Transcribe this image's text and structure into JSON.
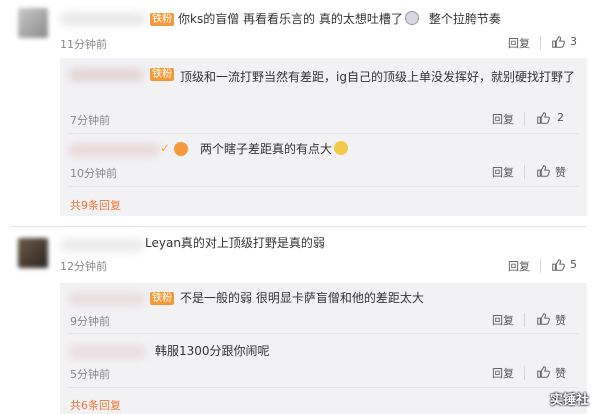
{
  "comments": [
    {
      "text": "你ks的盲僧 再看看乐言的 真的太想吐槽了",
      "text_tail": "整个拉胯节奏",
      "time": "11分钟前",
      "reply_label": "回复",
      "likes": "3",
      "replies": [
        {
          "text": "顶级和一流打野当然有差距，ig自己的顶级上单没发挥好，就别硬找打野了",
          "time": "7分钟前",
          "reply_label": "回复",
          "likes": "2"
        },
        {
          "text": "两个瞎子差距真的有点大",
          "time": "10分钟前",
          "reply_label": "回复",
          "likes": "赞"
        }
      ],
      "more_label": "共9条回复"
    },
    {
      "name_visible": "Leyan",
      "text": "真的对上顶级打野是真的弱",
      "time": "12分钟前",
      "reply_label": "回复",
      "likes": "5",
      "replies": [
        {
          "text": "不是一般的弱 很明显卡萨盲僧和他的差距太大",
          "time": "9分钟前",
          "reply_label": "回复",
          "likes": "赞"
        },
        {
          "text": "韩服1300分跟你闹呢",
          "time": "5分钟前",
          "reply_label": "回复",
          "likes": "赞"
        }
      ],
      "more_label": "共6条回复"
    }
  ],
  "fan_badge": "铁粉",
  "watermark": "实锤社",
  "colors": {
    "accent": "#e8783a",
    "badge": "#f59a3b",
    "panel": "#f2f2f5"
  }
}
